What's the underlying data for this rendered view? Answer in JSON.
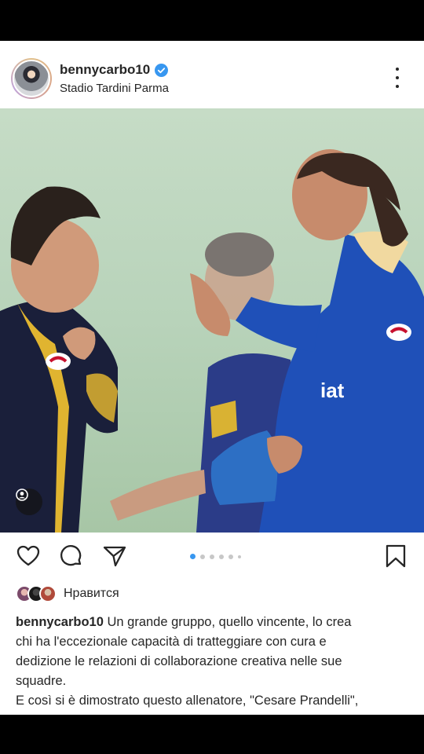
{
  "post": {
    "username": "bennycarbo10",
    "location": "Stadio Tardini Parma",
    "verified": true,
    "likes_label": "Нравится",
    "caption_lines": [
      "Un grande gruppo, quello vincente, lo crea",
      "chi ha l'eccezionale capacità di tratteggiare con cura e",
      "dedizione le relazioni di collaborazione creativa nelle sue",
      "squadre.",
      "E così si è dimostrato questo allenatore, \"Cesare Prandelli\","
    ],
    "carousel": {
      "total": 6,
      "active_index": 0
    }
  },
  "icons": {
    "like": "heart-icon",
    "comment": "comment-icon",
    "share": "send-icon",
    "save": "bookmark-icon",
    "more": "more-options-icon",
    "tag": "user-tag-icon"
  },
  "colors": {
    "accent": "#3897f0",
    "text": "#262626"
  }
}
